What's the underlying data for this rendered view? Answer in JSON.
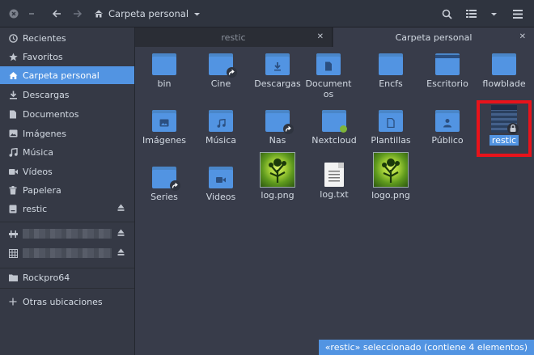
{
  "header": {
    "location": "Carpeta personal"
  },
  "sidebar": {
    "items": [
      {
        "label": "Recientes",
        "icon": "clock-icon"
      },
      {
        "label": "Favoritos",
        "icon": "star-icon"
      },
      {
        "label": "Carpeta personal",
        "icon": "home-icon"
      },
      {
        "label": "Descargas",
        "icon": "download-icon"
      },
      {
        "label": "Documentos",
        "icon": "document-icon"
      },
      {
        "label": "Imágenes",
        "icon": "image-icon"
      },
      {
        "label": "Música",
        "icon": "music-icon"
      },
      {
        "label": "Vídeos",
        "icon": "video-icon"
      },
      {
        "label": "Papelera",
        "icon": "trash-icon"
      },
      {
        "label": "restic",
        "icon": "drive-icon"
      }
    ],
    "devices": [
      {
        "label": "Rockpro64",
        "icon": "folder-icon"
      },
      {
        "label": "Otras ubicaciones",
        "icon": "plus-icon"
      }
    ]
  },
  "tabs": [
    {
      "label": "restic"
    },
    {
      "label": "Carpeta personal"
    }
  ],
  "files": [
    {
      "name": "bin"
    },
    {
      "name": "Cine"
    },
    {
      "name": "Descargas"
    },
    {
      "name": "Documentos"
    },
    {
      "name": "Encfs"
    },
    {
      "name": "Escritorio"
    },
    {
      "name": "flowblade"
    },
    {
      "name": "Imágenes"
    },
    {
      "name": "Música"
    },
    {
      "name": "Nas"
    },
    {
      "name": "Nextcloud"
    },
    {
      "name": "Plantillas"
    },
    {
      "name": "Público"
    },
    {
      "name": "restic"
    },
    {
      "name": "Series"
    },
    {
      "name": "Videos"
    },
    {
      "name": "log.png"
    },
    {
      "name": "log.txt"
    },
    {
      "name": "logo.png"
    }
  ],
  "status": {
    "text": "«restic» seleccionado  (contiene 4 elementos)"
  },
  "colors": {
    "accent": "#5294e2",
    "highlight_border": "#e8131b",
    "folder": "#5294e2"
  }
}
